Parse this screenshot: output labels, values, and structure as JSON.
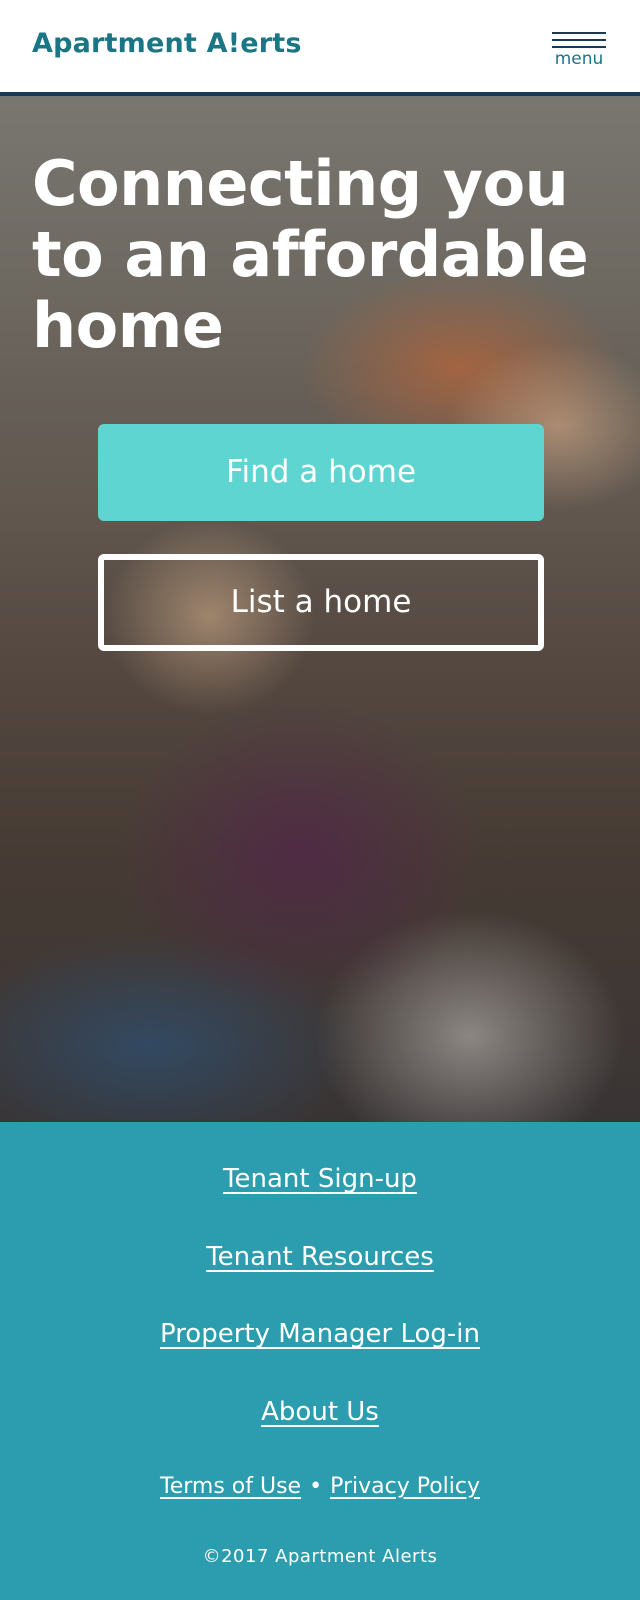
{
  "header": {
    "logo_text": "Apartment A!erts",
    "menu_label": "menu"
  },
  "hero": {
    "title": "Connecting you to an affordable home",
    "find_button": "Find a home",
    "list_button": "List a home"
  },
  "footer": {
    "links": [
      "Tenant Sign-up",
      "Tenant Resources",
      "Property Manager Log-in",
      "About Us"
    ],
    "terms": "Terms of Use",
    "separator": "•",
    "privacy": "Privacy Policy",
    "copyright": "©2017 Apartment Alerts"
  },
  "colors": {
    "brand_teal": "#1a7585",
    "accent_turquoise": "#5ed5d0",
    "footer_bg": "#2b9dae",
    "header_border": "#183a55"
  }
}
